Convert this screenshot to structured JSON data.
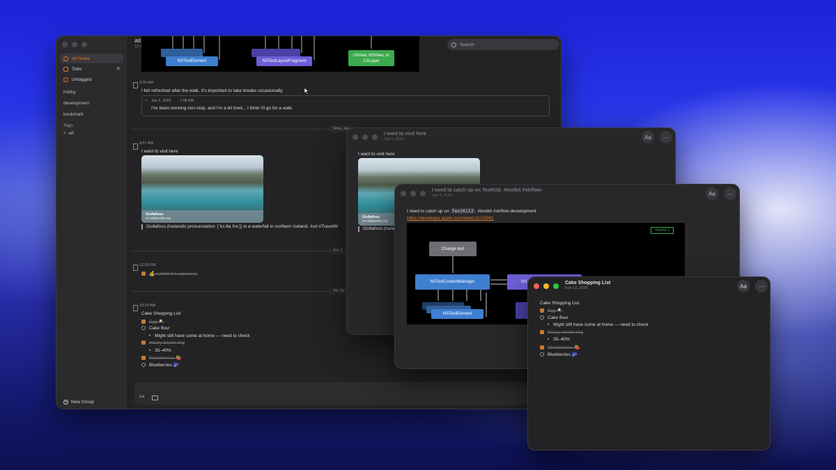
{
  "main_window": {
    "sidebar": {
      "items": [
        {
          "label": "All Notes",
          "badge": ""
        },
        {
          "label": "Todo",
          "badge": "4"
        },
        {
          "label": "Untagged",
          "badge": ""
        }
      ],
      "groups": [
        "hobby",
        "development",
        "bookmark"
      ],
      "tags_heading": "Tags",
      "tag": "url",
      "new_group": "New Group"
    },
    "header": {
      "title": "All Notes",
      "count": "13 notes"
    },
    "search_placeholder": "Search",
    "diagram_top": {
      "n1": "NSTextElement",
      "n2": "NSTextLayoutFragment",
      "n3": "UIView, NSView, or CALayer"
    },
    "entry1": {
      "time": "9:20 AM",
      "text": "I felt refreshed after the walk. It's important to take breaks occasionally.",
      "quote_date": "Jan 2, 2026",
      "quote_time": "7:05 AM",
      "quote_text": "I've been working non-stop, and I'm a bit tired... I think I'll go for a walk."
    },
    "day1": "Mon, Jan",
    "entry2": {
      "time": "9:57 AM",
      "text": "I want to visit here",
      "img_title": "Goðafoss",
      "img_url": "en.wikipedia.org",
      "caption": "Goðafoss (Icelandic pronunciation: [ˈkɔːðaˌfɔsː]) is a waterfall in northern Iceland. #url #TravelW"
    },
    "day2": "Fri, J",
    "entry3": {
      "time": "12:00 PM",
      "text": "💰 submit the expenses"
    },
    "day3": "Fri, Fe",
    "entry4": {
      "time": "10:24 AM",
      "title": "Cake Shopping List",
      "items": [
        {
          "text": "Egg 🍳",
          "checked": true
        },
        {
          "text": "Cake flour",
          "checked": false
        },
        {
          "text": "Heavy cream 10g",
          "checked": true
        },
        {
          "text": "Strawberries 🍓",
          "checked": true
        },
        {
          "text": "Blueberries 🫐",
          "checked": false
        }
      ],
      "sub1": "Might still have some at home — need to check",
      "sub2": "35–40%"
    },
    "bottom_aa": "Aa"
  },
  "win2": {
    "title": "I want to visit here",
    "date": "Jan 5, 2026",
    "aa": "Aa",
    "more": "···",
    "text": "I want to visit here",
    "img_title": "Goðafoss",
    "img_url": "en.wikipedia.org",
    "caption": "Goðafoss (Icela"
  },
  "win3": {
    "title": "I need to catch up on TextKit2. #textkit #strflow-",
    "date": "Jan 4, 2026",
    "aa": "Aa",
    "more": "···",
    "line_pre": "I need to catch up on ",
    "code": "TextKit2",
    "line_post": ". #textkit #strflow-development",
    "link": "https://developer.apple.com/wwdc21/10061",
    "diagram": {
      "badge": "TextKit 2",
      "change_text": "Change text",
      "manager": "NSTextContentManager",
      "element": "NSTextElement",
      "partial": "NS"
    }
  },
  "win4": {
    "title": "Cake Shopping List",
    "date": "Feb 13, 2026",
    "aa": "Aa",
    "more": "···",
    "heading": "Cake Shopping List",
    "items": [
      {
        "text": "Egg 🍳",
        "checked": true
      },
      {
        "text": "Cake flour",
        "checked": false
      },
      {
        "text": "Heavy cream 10g",
        "checked": true
      },
      {
        "text": "Strawberries 🍓",
        "checked": true
      },
      {
        "text": "Blueberries 🫐",
        "checked": false
      }
    ],
    "sub1": "Might still have some at home — need to check",
    "sub2": "35–40%"
  },
  "colors": {
    "accent": "#d47b34",
    "node_blue": "#3f7fd0",
    "node_green": "#3daa4f",
    "node_purple": "#6d5fd8"
  }
}
